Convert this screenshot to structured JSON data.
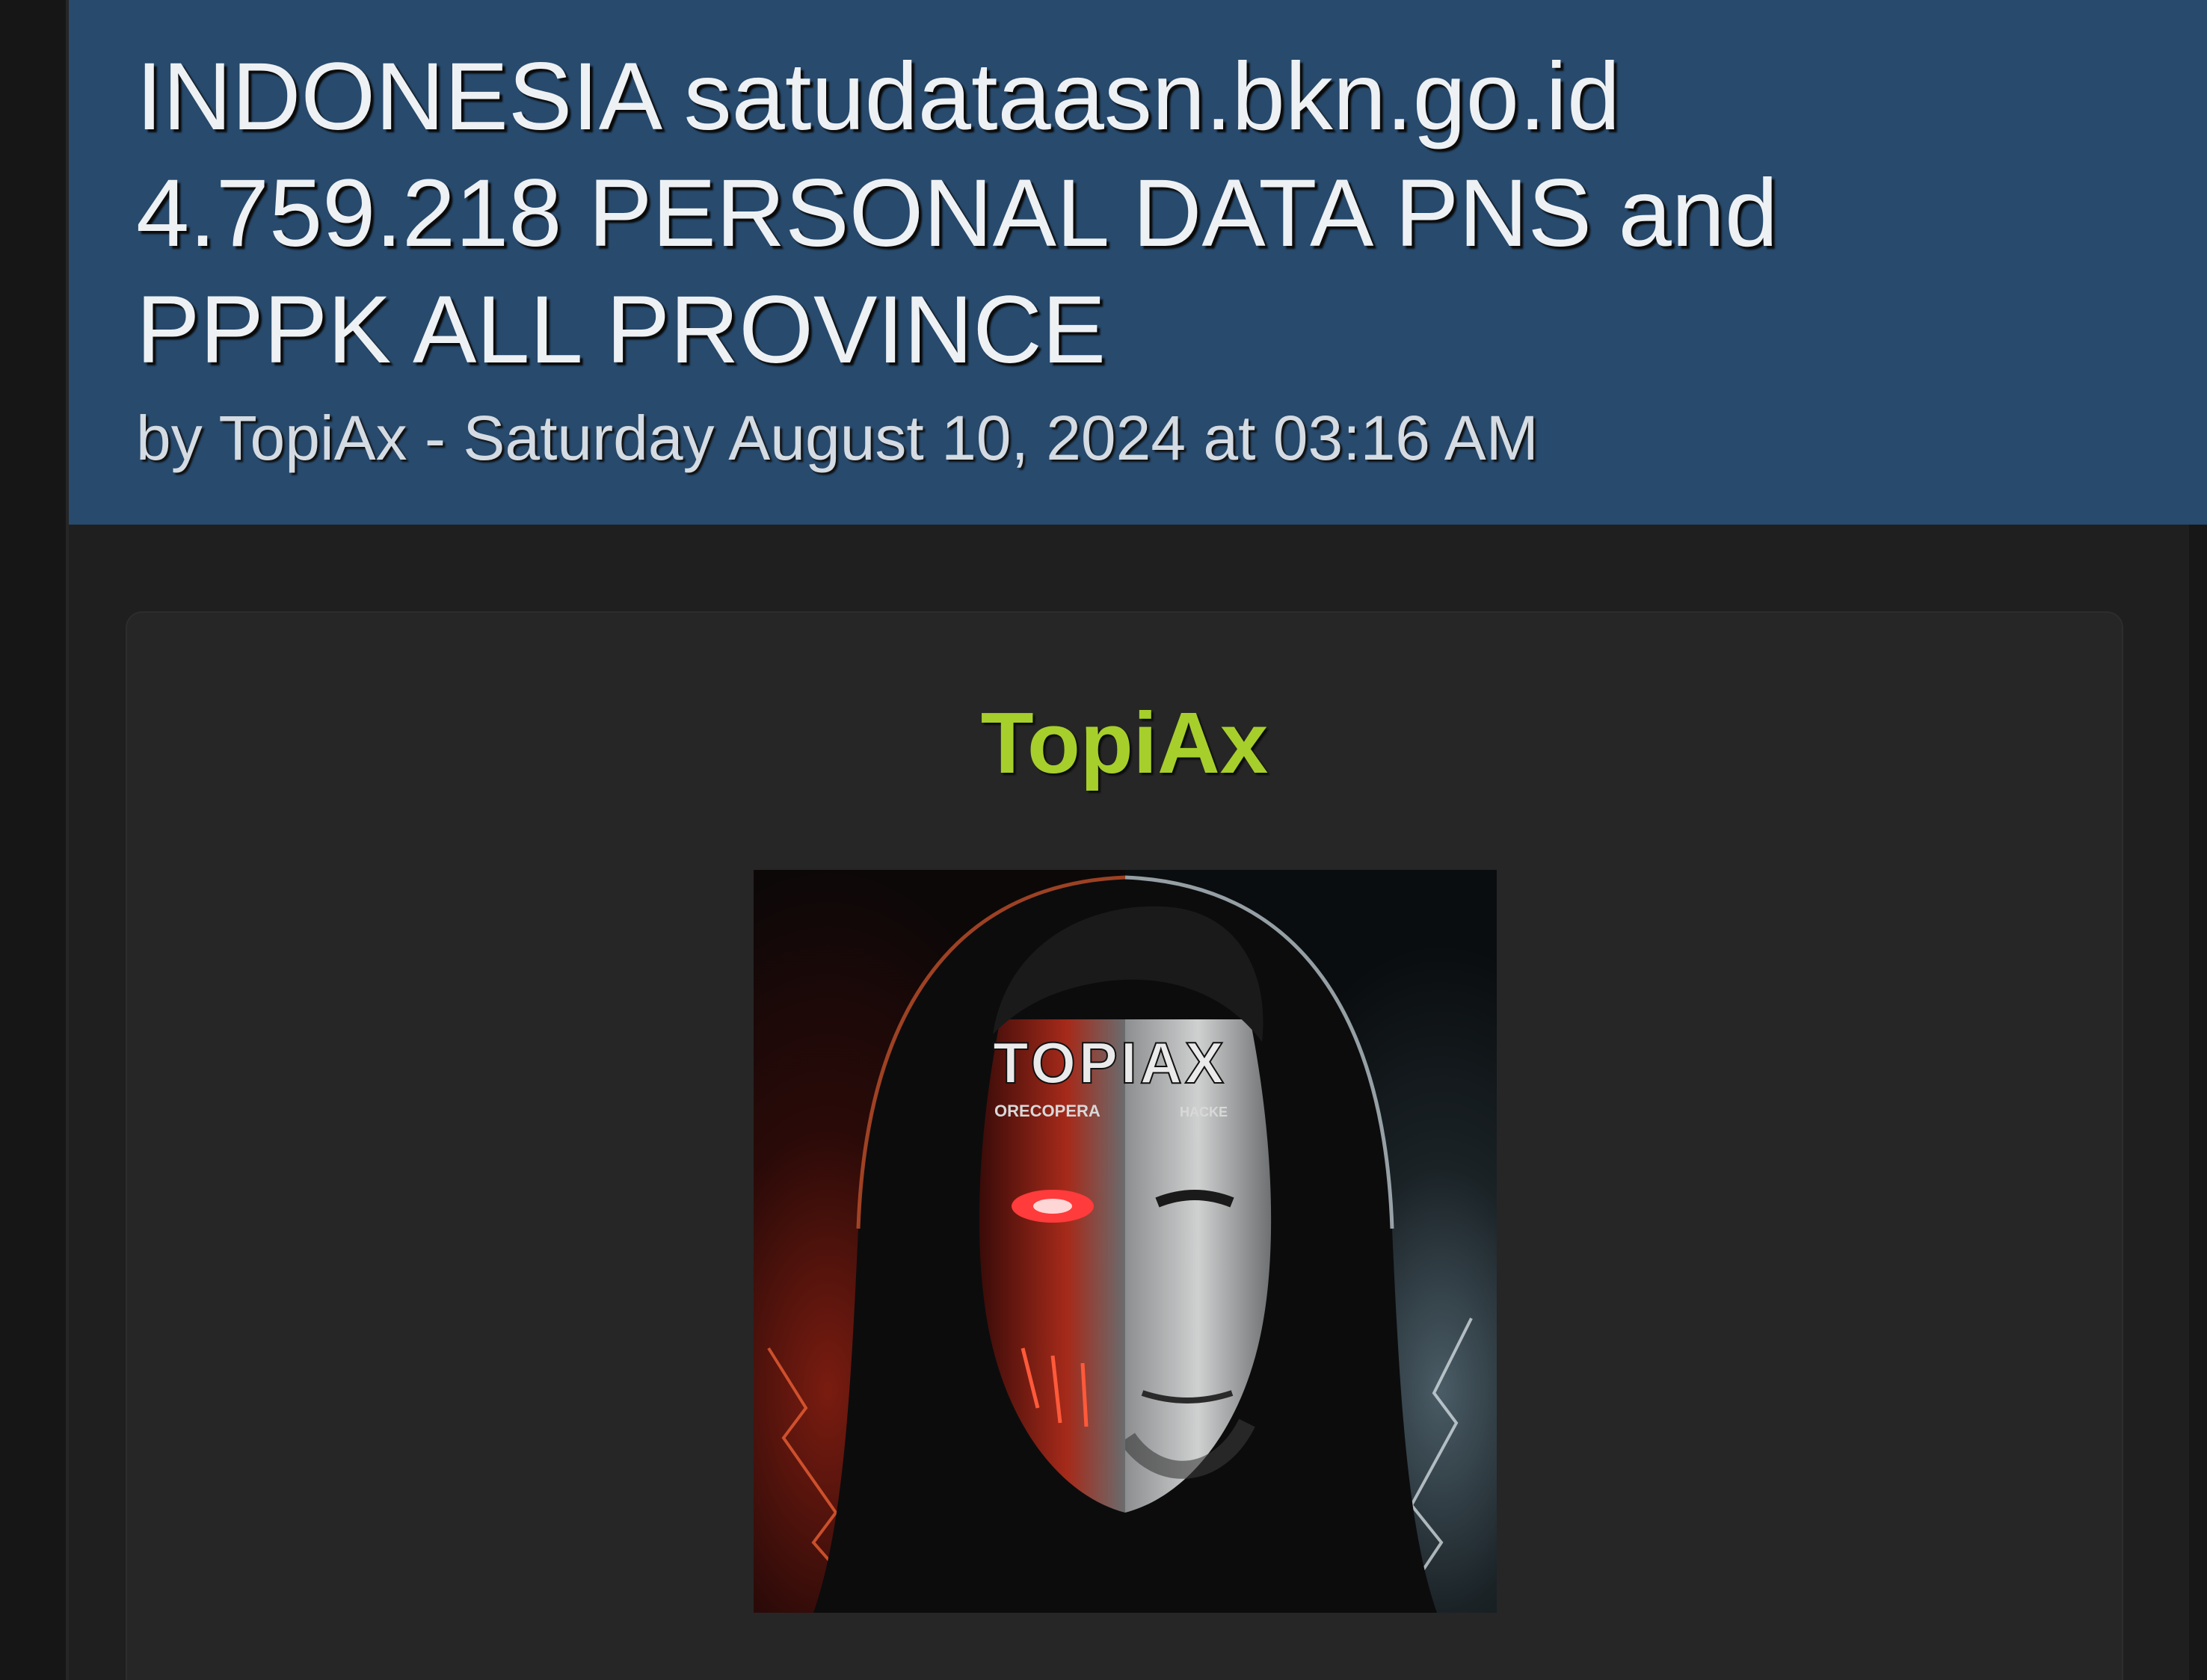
{
  "thread": {
    "title_line1": "INDONESIA satudataasn.bkn.go.id",
    "title_line2": "4.759.218 PERSONAL DATA PNS and",
    "title_line3": "PPPK ALL PROVINCE",
    "author_prefix": "by ",
    "author": "TopiAx",
    "date_separator": " - ",
    "date": "Saturday August 10, 2024 at 03:16 AM"
  },
  "post": {
    "author_name": "TopiAx",
    "avatar": {
      "icon": "hooded-hacker-avatar-icon",
      "logo_text": "TOPIAX",
      "subtext_left": "ORECOPERA",
      "subtext_right": "HACKE"
    }
  },
  "colors": {
    "header_bg": "#274a6d",
    "author_name": "#a6cf2c",
    "page_bg": "#1b1b1b",
    "card_bg": "#262626"
  }
}
